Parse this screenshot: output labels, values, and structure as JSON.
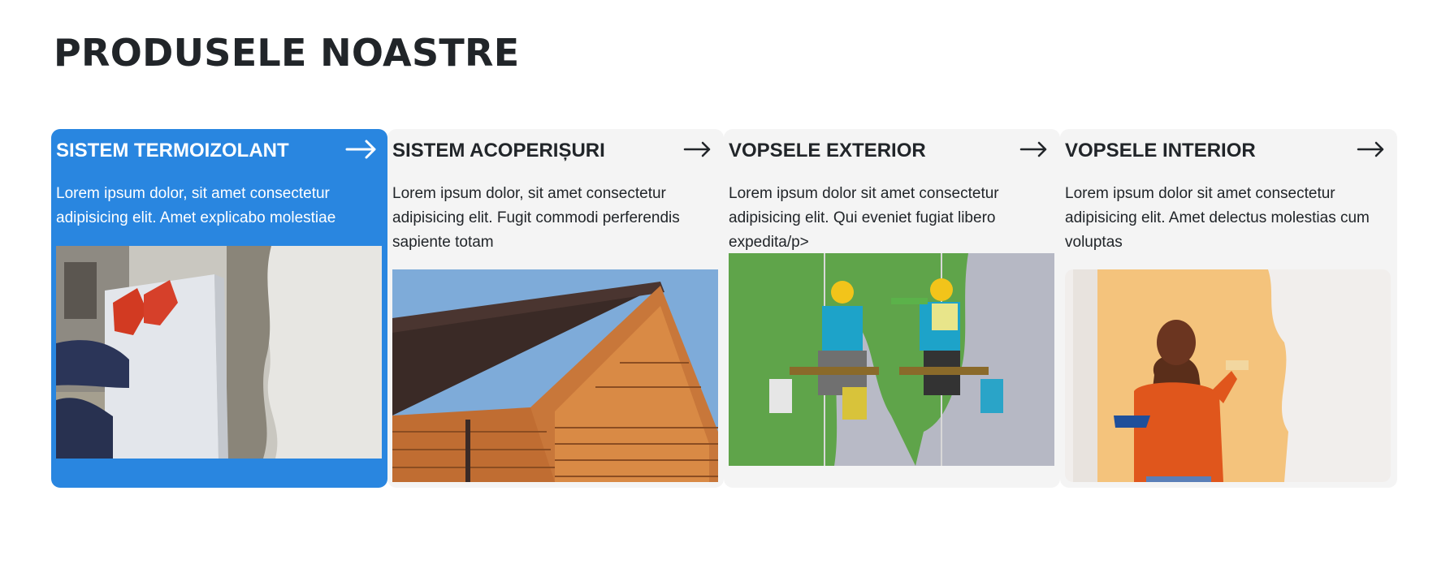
{
  "page": {
    "title": "PRODUSELE NOASTRE"
  },
  "cards": [
    {
      "title": "SISTEM TERMOIZOLANT",
      "description": "Lorem ipsum dolor, sit amet consectetur adipisicing elit. Amet explicabo molestiae",
      "image": "insulation-panel-photo",
      "active": true
    },
    {
      "title": "SISTEM ACOPERIȘURI",
      "description": "Lorem ipsum dolor, sit amet consectetur adipisicing elit. Fugit commodi perferendis sapiente totam",
      "image": "wooden-roof-photo",
      "active": false
    },
    {
      "title": "VOPSELE EXTERIOR",
      "description": "Lorem ipsum dolor sit amet consectetur adipisicing elit. Qui eveniet fugiat libero expedita/p>",
      "image": "facade-painters-photo",
      "active": false
    },
    {
      "title": "VOPSELE INTERIOR",
      "description": "Lorem ipsum dolor sit amet consectetur adipisicing elit. Amet delectus molestias cum voluptas",
      "image": "interior-painting-photo",
      "active": false
    }
  ],
  "colors": {
    "active_card": "#2986e0",
    "card": "#f4f4f4",
    "text": "#212529"
  },
  "icons": {
    "arrow": "arrow-right-icon"
  }
}
